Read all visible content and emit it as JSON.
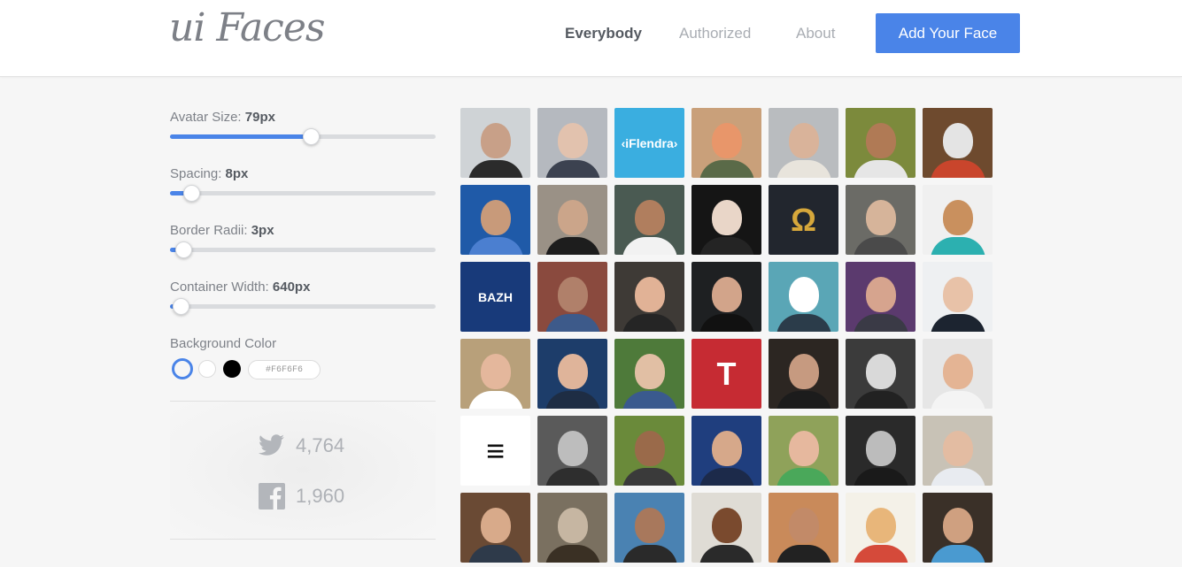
{
  "header": {
    "logo": "ui Faces",
    "nav": [
      "Everybody",
      "Authorized",
      "About"
    ],
    "cta_label": "Add Your Face"
  },
  "controls": {
    "avatar_size": {
      "label": "Avatar Size:",
      "value": "79px",
      "level": 0.53
    },
    "spacing": {
      "label": "Spacing:",
      "value": "8px",
      "level": 0.08
    },
    "border_radii": {
      "label": "Border Radii:",
      "value": "3px",
      "level": 0.05
    },
    "container_width": {
      "label": "Container Width:",
      "value": "640px",
      "level": 0.04
    },
    "background_color": {
      "label": "Background Color",
      "swatches": [
        "#F6F6F6",
        "#FFFFFF",
        "#000000"
      ],
      "hex_value": "#F6F6F6"
    }
  },
  "social": {
    "twitter_count": "4,764",
    "facebook_count": "1,960"
  },
  "colors": {
    "accent": "#4a84e8",
    "page_bg": "#f6f6f6"
  },
  "faces": [
    {
      "bg": "#cfd3d6",
      "skin": "#c8a088",
      "shirt": "#2b2b2b"
    },
    {
      "bg": "#b5b9bf",
      "skin": "#e2c2ae",
      "shirt": "#3c4250"
    },
    {
      "bg": "#3aaee0",
      "text": "‹iFlendra›"
    },
    {
      "bg": "#c9a07a",
      "skin": "#e8966a",
      "shirt": "#5a6a48"
    },
    {
      "bg": "#b9bcbf",
      "skin": "#d9b39a",
      "shirt": "#e8e4dc"
    },
    {
      "bg": "#7c8a3c",
      "skin": "#b07a55",
      "shirt": "#e6e6e6"
    },
    {
      "bg": "#6e4a2e",
      "skin": "#e4e4e4",
      "shirt": "#c9452c"
    },
    {
      "bg": "#1f5aa8",
      "skin": "#c89a7a",
      "shirt": "#4b7fd0"
    },
    {
      "bg": "#9a9186",
      "skin": "#cba58a",
      "shirt": "#1d1d1d"
    },
    {
      "bg": "#4a5a52",
      "skin": "#b07e5e",
      "shirt": "#f2f2f2"
    },
    {
      "bg": "#151515",
      "skin": "#e9d6c8",
      "shirt": "#242424"
    },
    {
      "bg": "#22262e",
      "text": "Ω",
      "textColor": "#d6a73b"
    },
    {
      "bg": "#6b6b66",
      "skin": "#d6b49a",
      "shirt": "#4a4a4a"
    },
    {
      "bg": "#f0f0f0",
      "skin": "#c9905e",
      "shirt": "#2cb0b0"
    },
    {
      "bg": "#183a7a",
      "text": "BAZH"
    },
    {
      "bg": "#8a4a3e",
      "skin": "#b0806a",
      "shirt": "#3d5a8a"
    },
    {
      "bg": "#3e3a36",
      "skin": "#e1b296",
      "shirt": "#252525"
    },
    {
      "bg": "#1e2022",
      "skin": "#d2a48a",
      "shirt": "#111111"
    },
    {
      "bg": "#5aa6b6",
      "skin": "#ffffff",
      "shirt": "#2b3c4a"
    },
    {
      "bg": "#5b3a6e",
      "skin": "#d6a48e",
      "shirt": "#3a3a46"
    },
    {
      "bg": "#eef0f2",
      "skin": "#e8c2a8",
      "shirt": "#1c2430"
    },
    {
      "bg": "#b8a07a",
      "skin": "#e4b79c",
      "shirt": "#ffffff"
    },
    {
      "bg": "#1d3d6a",
      "skin": "#dfb49a",
      "shirt": "#1e2d44"
    },
    {
      "bg": "#4e7a3a",
      "skin": "#e1bfa4",
      "shirt": "#3a5a8e"
    },
    {
      "bg": "#c62b33",
      "text": "T"
    },
    {
      "bg": "#2c2622",
      "skin": "#c69a80",
      "shirt": "#1c1c1c"
    },
    {
      "bg": "#3b3b3b",
      "skin": "#d9d9d9",
      "shirt": "#222222"
    },
    {
      "bg": "#e6e6e6",
      "skin": "#e4b494",
      "shirt": "#f4f4f4"
    },
    {
      "bg": "#ffffff",
      "text": "≡",
      "textColor": "#111111"
    },
    {
      "bg": "#5a5a5a",
      "skin": "#bdbdbd",
      "shirt": "#2e2e2e"
    },
    {
      "bg": "#6a8a3a",
      "skin": "#9a6a4a",
      "shirt": "#3a3a3a"
    },
    {
      "bg": "#1f3e7e",
      "skin": "#d6a88a",
      "shirt": "#1c2a4a"
    },
    {
      "bg": "#8fa25a",
      "skin": "#e6b89e",
      "shirt": "#4aa85a"
    },
    {
      "bg": "#2a2a2a",
      "skin": "#bcbcbc",
      "shirt": "#1a1a1a"
    },
    {
      "bg": "#c8c2b6",
      "skin": "#e3bca2",
      "shirt": "#e8ebf0"
    },
    {
      "bg": "#6a4a34",
      "skin": "#d8aa8a",
      "shirt": "#2e3a4a"
    },
    {
      "bg": "#7a7060",
      "skin": "#c6b6a2",
      "shirt": "#3a3024"
    },
    {
      "bg": "#4a82b2",
      "skin": "#a8785c",
      "shirt": "#2a2a2a"
    },
    {
      "bg": "#dfdcd5",
      "skin": "#7a4a2e",
      "shirt": "#2a2a2a"
    },
    {
      "bg": "#c98a5a",
      "skin": "#c28a68",
      "shirt": "#222222"
    },
    {
      "bg": "#f4f1e8",
      "skin": "#e8b67a",
      "shirt": "#d54a3a"
    },
    {
      "bg": "#3a3028",
      "skin": "#cfa080",
      "shirt": "#4a9ad0"
    }
  ]
}
